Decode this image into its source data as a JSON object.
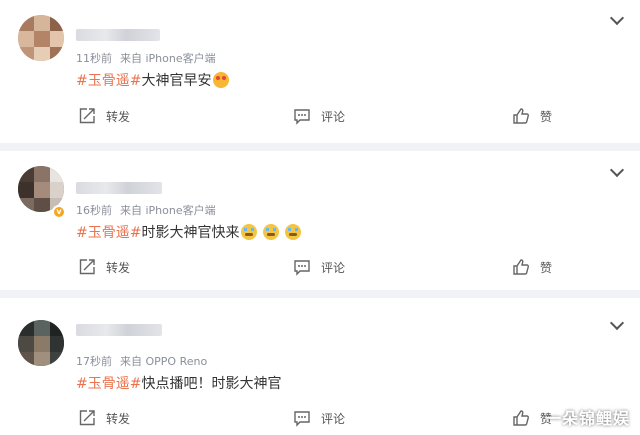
{
  "posts": [
    {
      "time": "11秒前",
      "source": "来自 iPhone客户端",
      "topic": "#玉骨遥#",
      "text": "大神官早安",
      "emojis": [
        "love-face"
      ],
      "actions": {
        "repost": "转发",
        "comment": "评论",
        "like": "赞"
      }
    },
    {
      "time": "16秒前",
      "source": "来自 iPhone客户端",
      "topic": "#玉骨遥#",
      "text": "时影大神官快来",
      "emojis": [
        "crying-face",
        "crying-face",
        "crying-face"
      ],
      "actions": {
        "repost": "转发",
        "comment": "评论",
        "like": "赞"
      }
    },
    {
      "time": "17秒前",
      "source": "来自 OPPO Reno",
      "topic": "#玉骨遥#",
      "text": "快点播吧！时影大神官",
      "emojis": [],
      "actions": {
        "repost": "转发",
        "comment": "评论",
        "like": "赞"
      }
    }
  ],
  "watermark": "一朵锦鲤娱",
  "colors": {
    "topic": "#eb7350",
    "meta": "#8a8f99",
    "background": "#f1f2f5",
    "verified": "#f5a623"
  }
}
